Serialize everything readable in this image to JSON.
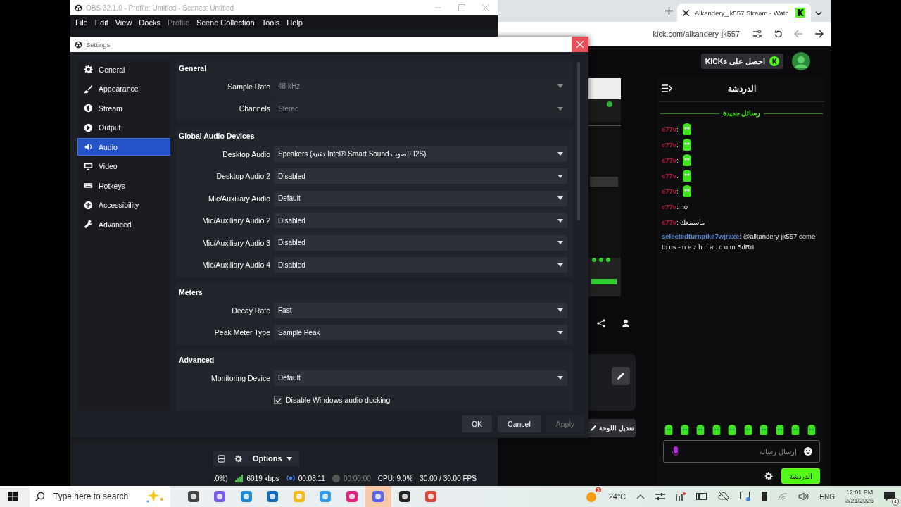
{
  "obs_window": {
    "title": "OBS 32.1.0 - Profile: Untitled - Scenes: Untitled",
    "menu": [
      {
        "label": "File",
        "disabled": false
      },
      {
        "label": "Edit",
        "disabled": false
      },
      {
        "label": "View",
        "disabled": false
      },
      {
        "label": "Docks",
        "disabled": false
      },
      {
        "label": "Profile",
        "disabled": true
      },
      {
        "label": "Scene Collection",
        "disabled": false
      },
      {
        "label": "Tools",
        "disabled": false
      },
      {
        "label": "Help",
        "disabled": false
      }
    ],
    "options_button": "Options",
    "status_bar": {
      "cpu_cut": ".0%)",
      "bitrate": "6019 kbps",
      "stream_time": "00:08:11",
      "record_time": "00:00:00",
      "cpu": "CPU: 9.0%",
      "fps": "30.00 / 30.00 FPS"
    }
  },
  "browser": {
    "tab_title": "Alkandery_jk557 Stream - Watc",
    "url": "kick.com/alkandery-jk557",
    "kicks_button": "احصل على KICKs",
    "chat_title": "الدردشة",
    "new_messages": "رسائل جديدة",
    "messages": [
      {
        "kind": "emote",
        "user": "c77v",
        "color": "#c4143e",
        "text": ":"
      },
      {
        "kind": "emote",
        "user": "c77v",
        "color": "#c4143e",
        "text": ":"
      },
      {
        "kind": "emote",
        "user": "c77v",
        "color": "#c4143e",
        "text": ":"
      },
      {
        "kind": "emote",
        "user": "c77v",
        "color": "#c4143e",
        "text": ":"
      },
      {
        "kind": "emote",
        "user": "c77v",
        "color": "#c4143e",
        "text": ":"
      },
      {
        "kind": "text",
        "user": "c77v",
        "color": "#c4143e",
        "text": ": no"
      },
      {
        "kind": "text",
        "user": "c77v",
        "color": "#c4143e",
        "text": ": ماسمعك"
      },
      {
        "kind": "text",
        "user": "selectedturnpike7wjraxe",
        "color": "#5b8fdb",
        "text": ": @alkandery-jk557 come to us - n e z h n a . c o m BdRrt"
      }
    ],
    "edit_layout_button": "تعديل اللوحة",
    "message_placeholder": "إرسال رسالة",
    "chat_button": "الدردشة"
  },
  "settings": {
    "title": "Settings",
    "sidebar": [
      {
        "label": "General",
        "selected": false
      },
      {
        "label": "Appearance",
        "selected": false
      },
      {
        "label": "Stream",
        "selected": false
      },
      {
        "label": "Output",
        "selected": false
      },
      {
        "label": "Audio",
        "selected": true
      },
      {
        "label": "Video",
        "selected": false
      },
      {
        "label": "Hotkeys",
        "selected": false
      },
      {
        "label": "Accessibility",
        "selected": false
      },
      {
        "label": "Advanced",
        "selected": false
      }
    ],
    "sections": [
      {
        "title": "General",
        "rows": [
          {
            "kind": "select",
            "label": "Sample Rate",
            "value": "48 kHz",
            "disabled": true
          },
          {
            "kind": "select",
            "label": "Channels",
            "value": "Stereo",
            "disabled": true
          }
        ]
      },
      {
        "title": "Global Audio Devices",
        "rows": [
          {
            "kind": "select",
            "label": "Desktop Audio",
            "value": "Speakers (تقنية Intel® Smart Sound للصوت I2S)",
            "disabled": false
          },
          {
            "kind": "select",
            "label": "Desktop Audio 2",
            "value": "Disabled",
            "disabled": false
          },
          {
            "kind": "select",
            "label": "Mic/Auxiliary Audio",
            "value": "Default",
            "disabled": false
          },
          {
            "kind": "select",
            "label": "Mic/Auxiliary Audio 2",
            "value": "Disabled",
            "disabled": false
          },
          {
            "kind": "select",
            "label": "Mic/Auxiliary Audio 3",
            "value": "Disabled",
            "disabled": false
          },
          {
            "kind": "select",
            "label": "Mic/Auxiliary Audio 4",
            "value": "Disabled",
            "disabled": false
          }
        ]
      },
      {
        "title": "Meters",
        "rows": [
          {
            "kind": "select",
            "label": "Decay Rate",
            "value": "Fast",
            "disabled": false
          },
          {
            "kind": "select",
            "label": "Peak Meter Type",
            "value": "Sample Peak",
            "disabled": false
          }
        ]
      },
      {
        "title": "Advanced",
        "rows": [
          {
            "kind": "select",
            "label": "Monitoring Device",
            "value": "Default",
            "disabled": false
          },
          {
            "kind": "checkbox",
            "label": "Disable Windows audio ducking",
            "checked": true
          }
        ]
      }
    ],
    "buttons": [
      {
        "label": "OK",
        "disabled": false
      },
      {
        "label": "Cancel",
        "disabled": false
      },
      {
        "label": "Apply",
        "disabled": true
      }
    ]
  },
  "taskbar": {
    "search_placeholder": "Type here to search",
    "weather_badge": "3",
    "weather": "24°C",
    "language": "ENG",
    "time": "12:01 PM",
    "date": "3/21/2026",
    "notifications": "4"
  }
}
